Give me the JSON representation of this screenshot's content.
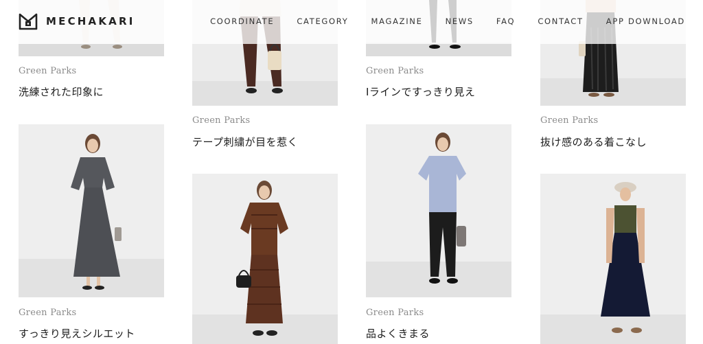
{
  "header": {
    "logo_text": "MECHAKARI",
    "nav": [
      "COORDINATE",
      "CATEGORY",
      "MAGAZINE",
      "NEWS",
      "FAQ",
      "CONTACT",
      "APP DOWNLOAD"
    ]
  },
  "columns": [
    {
      "cards": [
        {
          "brand": "Green Parks",
          "title": "洗練された印象に"
        },
        {
          "brand": "Green Parks",
          "title": "すっきり見えシルエット"
        }
      ]
    },
    {
      "cards": [
        {
          "brand": "Green Parks",
          "title": "テープ刺繍が目を惹く"
        },
        {
          "brand": "",
          "title": ""
        }
      ]
    },
    {
      "cards": [
        {
          "brand": "Green Parks",
          "title": "Iラインですっきり見え"
        },
        {
          "brand": "Green Parks",
          "title": "品よくきまる"
        }
      ]
    },
    {
      "cards": [
        {
          "brand": "Green Parks",
          "title": "抜け感のある着こなし"
        },
        {
          "brand": "",
          "title": ""
        }
      ]
    }
  ],
  "colors": {
    "text": "#1c1c1c",
    "brand_text": "#8a8a8a",
    "photo_bg": "#e9e9e9"
  }
}
